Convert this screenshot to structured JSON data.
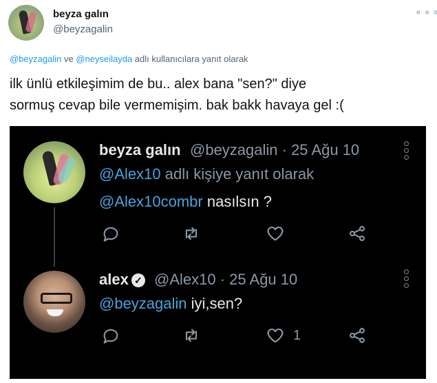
{
  "outer_tweet": {
    "author_name": "beyza galın",
    "author_handle": "@beyzagalin",
    "more_glyph": "⚬⚬⚬",
    "reply_to": {
      "mention1": "@beyzagalin",
      "connector": " ve ",
      "mention2": "@neyseilayda",
      "suffix": " adlı kullanıcılara yanıt olarak"
    },
    "text_line1": "ilk ünlü etkileşimim de bu.. alex bana \"sen?\" diye",
    "text_line2": "sormuş cevap bile vermemişim. bak bakk havaya gel :("
  },
  "embedded_screenshot": {
    "tweet1": {
      "author_name": "beyza galın",
      "meta": "@beyzagalin · 25 Ağu 10",
      "reply_mention": "@Alex10",
      "reply_suffix": " adlı kişiye yanıt olarak",
      "mention": "@Alex10combr",
      "text": " nasılsın ?"
    },
    "tweet2": {
      "author_name": "alex",
      "meta": "@Alex10 · 25 Ağu 10",
      "mention": "@beyzagalin",
      "text": " iyi,sen?",
      "like_count": "1"
    },
    "colors": {
      "background": "#000000",
      "link": "#4aa3df",
      "muted": "#8b98a5"
    }
  }
}
